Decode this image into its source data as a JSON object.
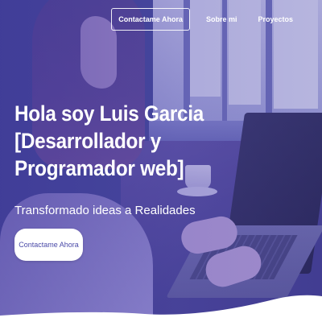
{
  "nav": {
    "contact_label": "Contactame Ahora",
    "about_label": "Sobre mi",
    "projects_label": "Proyectos"
  },
  "hero": {
    "title_lines": [
      "Hola soy Luis Garcia",
      "[Desarrollador y",
      "Programador web]"
    ],
    "subtitle": "Transformado ideas a Realidades",
    "cta_label": "Contactame Ahora"
  },
  "colors": {
    "overlay": "#4a3ca0",
    "cta_text": "#4a4aa8",
    "wave": "#ffffff"
  }
}
